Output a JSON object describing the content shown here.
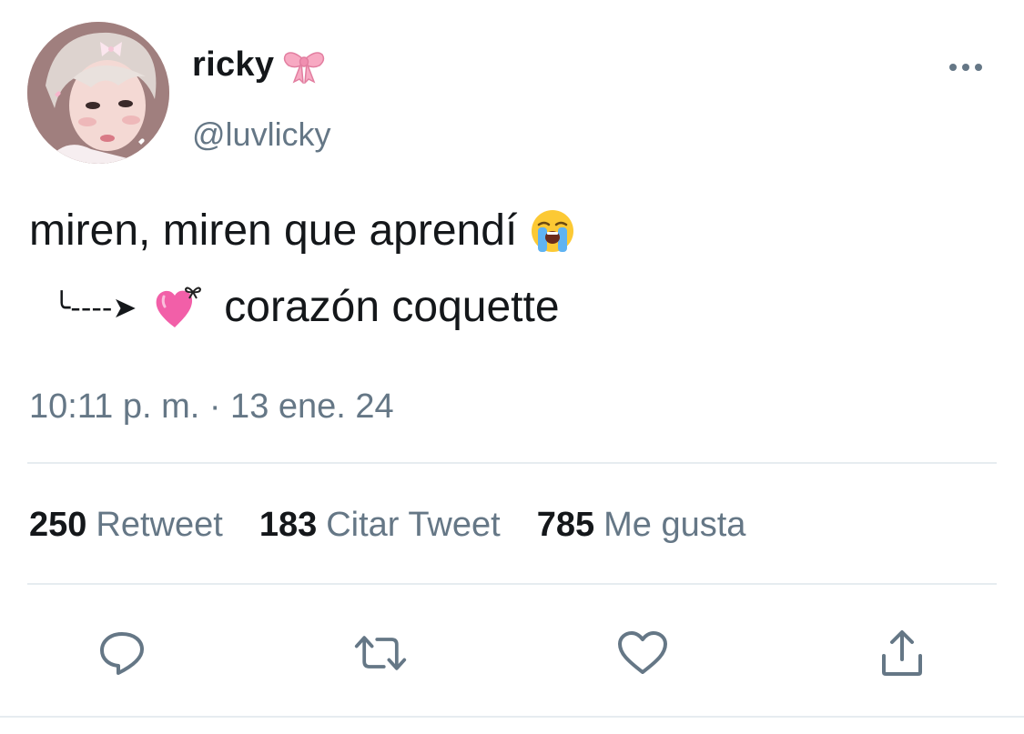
{
  "author": {
    "display_name": "ricky",
    "name_emoji": "bow-icon",
    "handle": "@luvlicky"
  },
  "tweet": {
    "line1_text": "miren, miren que aprendí",
    "line1_emoji": "loudly-crying-face-icon",
    "line2_arrow": "╰----➤",
    "line2_emoji": "pink-heart-with-bow-icon",
    "line2_text": "corazón coquette",
    "timestamp": "10:11 p. m. · 13 ene. 24"
  },
  "stats": [
    {
      "count": "250",
      "label": "Retweet"
    },
    {
      "count": "183",
      "label": "Citar Tweet"
    },
    {
      "count": "785",
      "label": "Me gusta"
    }
  ],
  "actions": [
    "reply-icon",
    "retweet-icon",
    "like-icon",
    "share-icon"
  ],
  "colors": {
    "text_primary": "#14171a",
    "text_secondary": "#657786",
    "divider": "#e6ecf0",
    "icon": "#657786",
    "accent_pink": "#f3a6c0"
  }
}
